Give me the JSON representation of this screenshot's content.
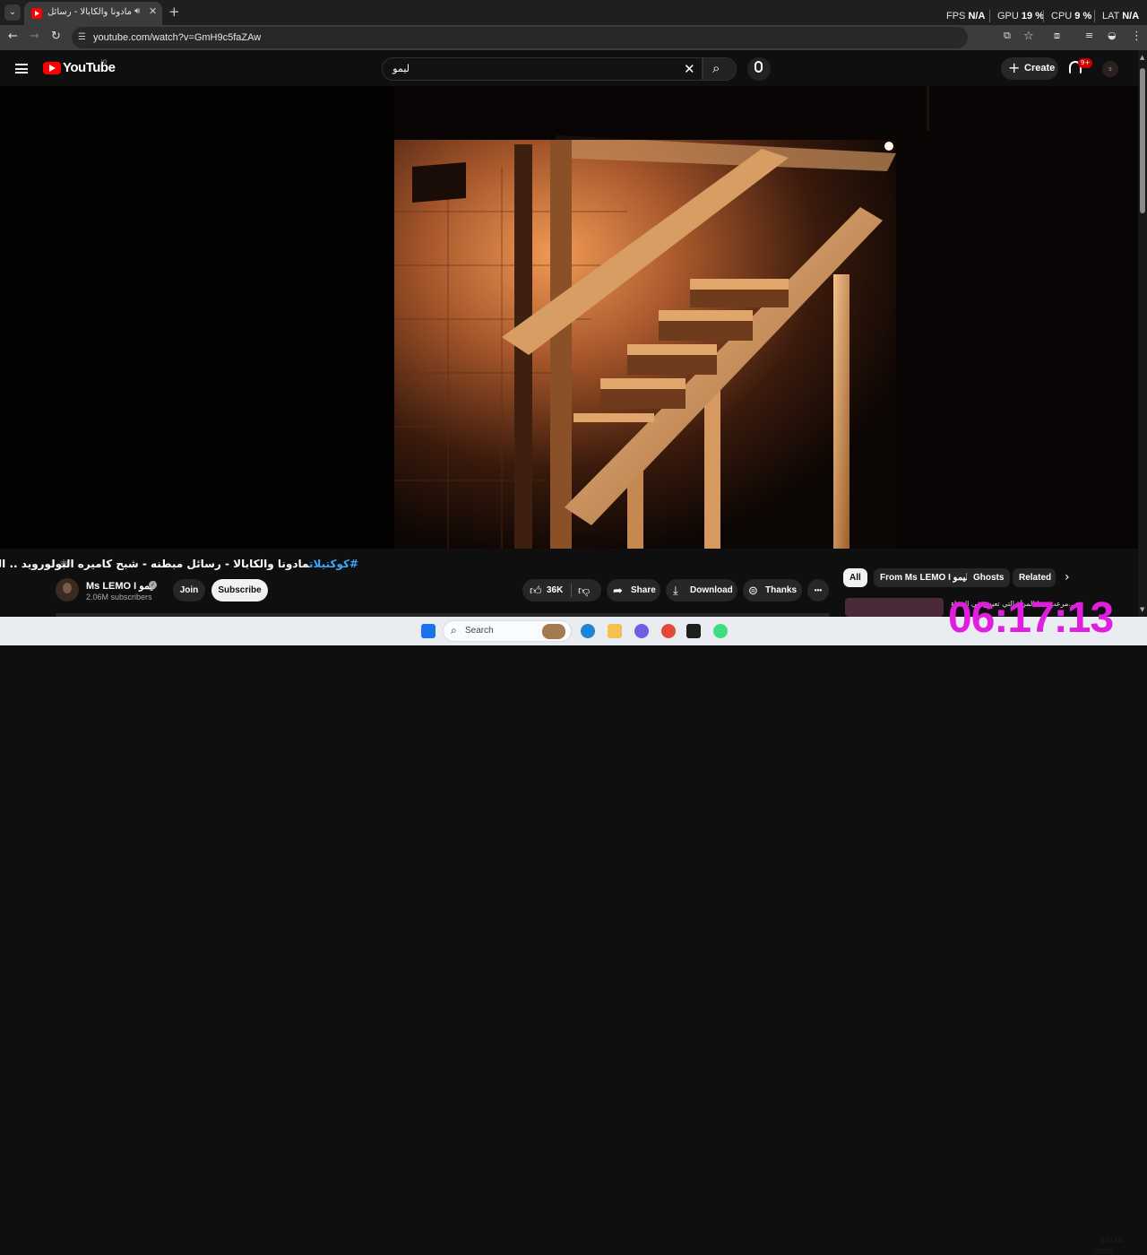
{
  "browser": {
    "tab_title": "مادونا والكابالا - رسائل م... (34)",
    "audio_icon": "speaker-icon",
    "url": "youtube.com/watch?v=GmH9c5faZAw"
  },
  "perf_overlay": {
    "fps_label": "FPS",
    "fps_value": "N/A",
    "gpu_label": "GPU",
    "gpu_value": "19 %",
    "cpu_label": "CPU",
    "cpu_value": "9 %",
    "lat_label": "LAT",
    "lat_value": "N/A"
  },
  "youtube": {
    "wordmark": "YouTube",
    "country_code": "JO",
    "search_value": "ليمو",
    "create_label": "Create",
    "notification_count": "9+",
    "avatar_letter": "s"
  },
  "video": {
    "title_hashtag": "#كوكتيلات",
    "title_text": "مادونا والكابالا - رسائل مبطنه - شبح كاميره البولورويد .. الخ",
    "title_emoji": "⚛",
    "channel_name": "Ms LEMO I ليمو",
    "subscribers": "2.06M subscribers",
    "join_label": "Join",
    "subscribe_label": "Subscribe",
    "like_count": "36K",
    "share_label": "Share",
    "download_label": "Download",
    "thanks_label": "Thanks",
    "more_label": "•••"
  },
  "chips": [
    "All",
    "From Ms LEMO I ليمو",
    "Ghosts",
    "Related"
  ],
  "related": {
    "title": "...مرعب جدا المرأة التي تعيش في الخفاء"
  },
  "taskbar": {
    "search_label": "Search",
    "tray_time": "3:32 AM",
    "tray_date": "1/2025"
  },
  "overlay_clock": "06:17:13",
  "colors": {
    "youtube_red": "#ff0000",
    "link_blue": "#3ea6ff",
    "clock_magenta": "#e01ee0"
  }
}
